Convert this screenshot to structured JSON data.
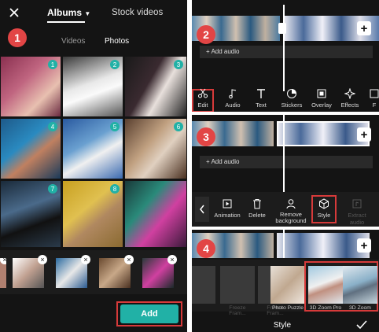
{
  "steps": [
    "1",
    "2",
    "3",
    "4"
  ],
  "picker": {
    "close_icon": "close-icon",
    "albums_label": "Albums",
    "stock_label": "Stock videos",
    "tab_videos": "Videos",
    "tab_photos": "Photos",
    "photo_numbers": [
      "1",
      "2",
      "3",
      "4",
      "5",
      "6",
      "7",
      "8"
    ],
    "add_label": "Add",
    "accent": "#21b1a6"
  },
  "panel2": {
    "add_audio": "+ Add audio",
    "toolbar": [
      "Edit",
      "Audio",
      "Text",
      "Stickers",
      "Overlay",
      "Effects",
      "F"
    ]
  },
  "panel3": {
    "add_audio": "+ Add audio",
    "toolbar": [
      "Animation",
      "Delete",
      "Remove background",
      "Style",
      "Extract audio"
    ]
  },
  "panel4": {
    "styles": [
      "Freeze Fram...",
      "Freeze Fram...",
      "Photo Puzzle",
      "3D Zoom Pro",
      "3D Zoom"
    ],
    "footer_title": "Style"
  }
}
